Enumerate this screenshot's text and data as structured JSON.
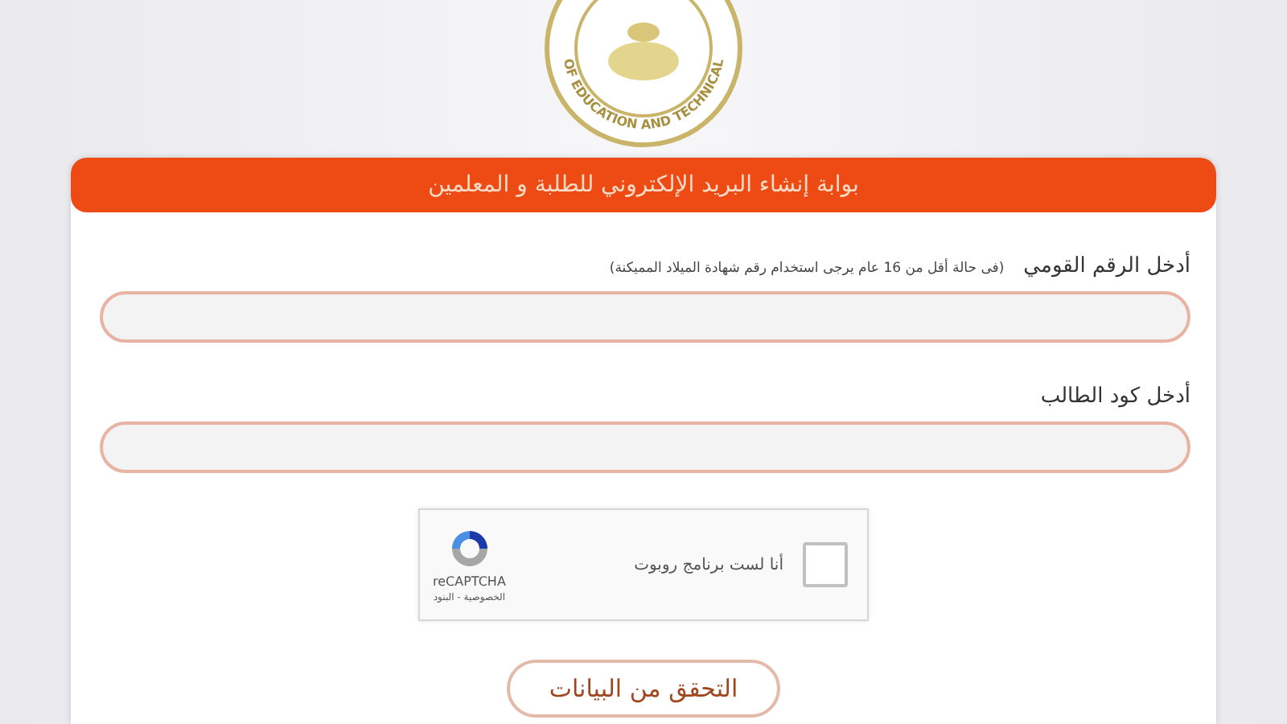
{
  "logo": {
    "ring_text": "OF EDUCATION AND TECHNICAL"
  },
  "header": {
    "title": "بوابة إنشاء البريد الإلكتروني للطلبة و المعلمين"
  },
  "fields": [
    {
      "label": "أدخل الرقم القومي",
      "hint": "(فى حالة أقل من 16 عام يرجى استخدام رقم شهادة الميلاد المميكنة)"
    },
    {
      "label": "أدخل كود الطالب"
    }
  ],
  "captcha": {
    "label": "أنا لست برنامج روبوت",
    "checked": false,
    "brand": "reCAPTCHA",
    "links": "الخصوصية - البنود"
  },
  "submit": {
    "label": "التحقق من البيانات"
  }
}
